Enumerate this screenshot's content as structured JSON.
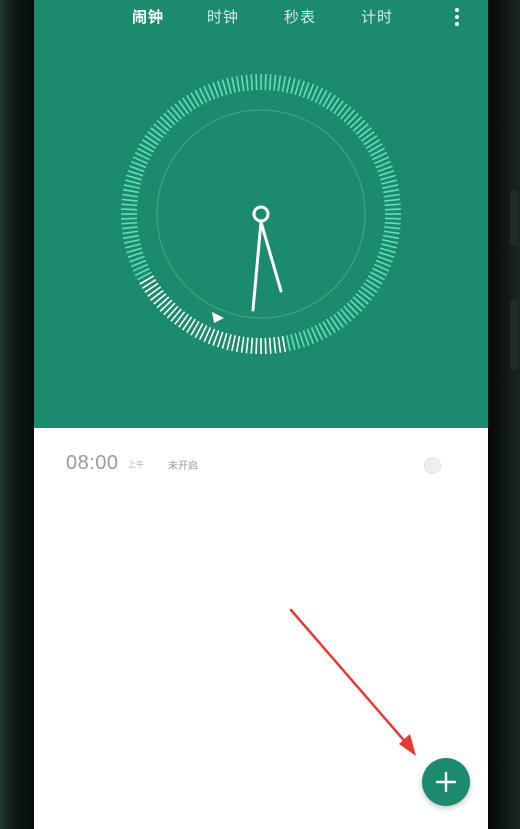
{
  "tabs": [
    {
      "label": "闹钟",
      "active": true
    },
    {
      "label": "时钟",
      "active": false
    },
    {
      "label": "秒表",
      "active": false
    },
    {
      "label": "计时",
      "active": false
    }
  ],
  "alarm": {
    "time": "08:00",
    "period": "上午",
    "status": "未开启",
    "enabled": false
  },
  "icons": {
    "more": "more-vertical-icon",
    "add": "plus-icon",
    "annotation": "red-arrow"
  },
  "colors": {
    "accent": "#1c8a6c",
    "ticks": "#5fe0bb",
    "annotation": "#e53935"
  }
}
